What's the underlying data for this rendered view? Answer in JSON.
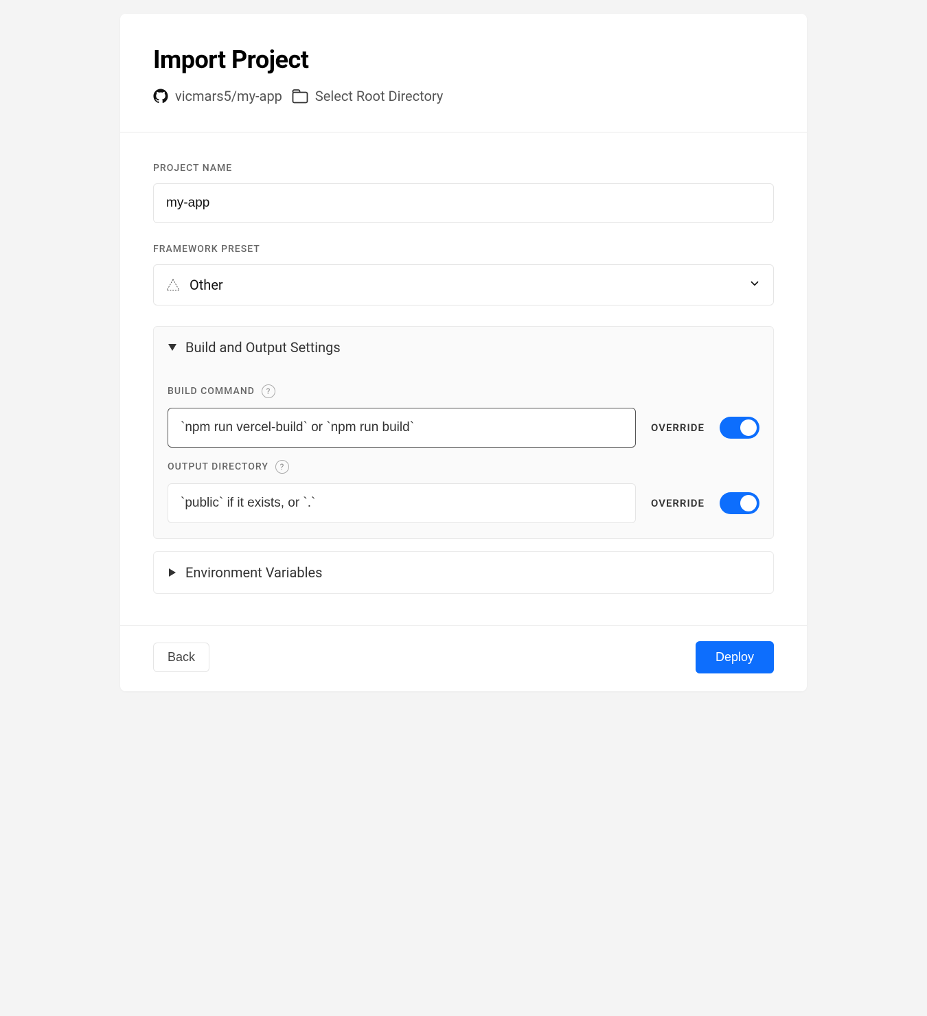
{
  "header": {
    "title": "Import Project",
    "repo": "vicmars5/my-app",
    "root_directory_label": "Select Root Directory"
  },
  "form": {
    "project_name": {
      "label": "PROJECT NAME",
      "value": "my-app"
    },
    "framework_preset": {
      "label": "FRAMEWORK PRESET",
      "value": "Other"
    },
    "build_output": {
      "title": "Build and Output Settings",
      "build_command": {
        "label": "BUILD COMMAND",
        "placeholder": "`npm run vercel-build` or `npm run build`",
        "override_label": "OVERRIDE",
        "override": true
      },
      "output_directory": {
        "label": "OUTPUT DIRECTORY",
        "placeholder": "`public` if it exists, or `.`",
        "override_label": "OVERRIDE",
        "override": true
      }
    },
    "env_vars": {
      "title": "Environment Variables"
    }
  },
  "footer": {
    "back_label": "Back",
    "deploy_label": "Deploy"
  }
}
